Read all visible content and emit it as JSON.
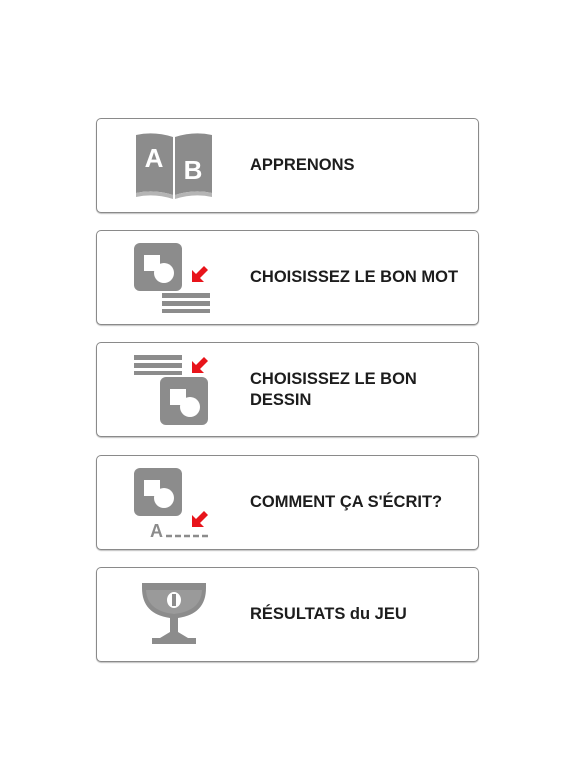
{
  "menu": {
    "items": [
      {
        "label": "APPRENONS",
        "icon": "book-ab-icon"
      },
      {
        "label": "CHOISISSEZ LE BON MOT",
        "icon": "picture-to-word-icon"
      },
      {
        "label": "CHOISISSEZ LE BON\nDESSIN",
        "icon": "word-to-picture-icon"
      },
      {
        "label": "COMMENT ÇA S'ÉCRIT?",
        "icon": "spelling-icon"
      },
      {
        "label": "RÉSULTATS du JEU",
        "icon": "trophy-cup-icon"
      }
    ],
    "icon_texts": {
      "book_left": "A",
      "book_right": "B",
      "spelling_letter": "A"
    }
  },
  "colors": {
    "icon_gray": "#8c8c8c",
    "arrow_red": "#e8141b",
    "text": "#1d1d1d",
    "border": "#8a8a8a"
  }
}
